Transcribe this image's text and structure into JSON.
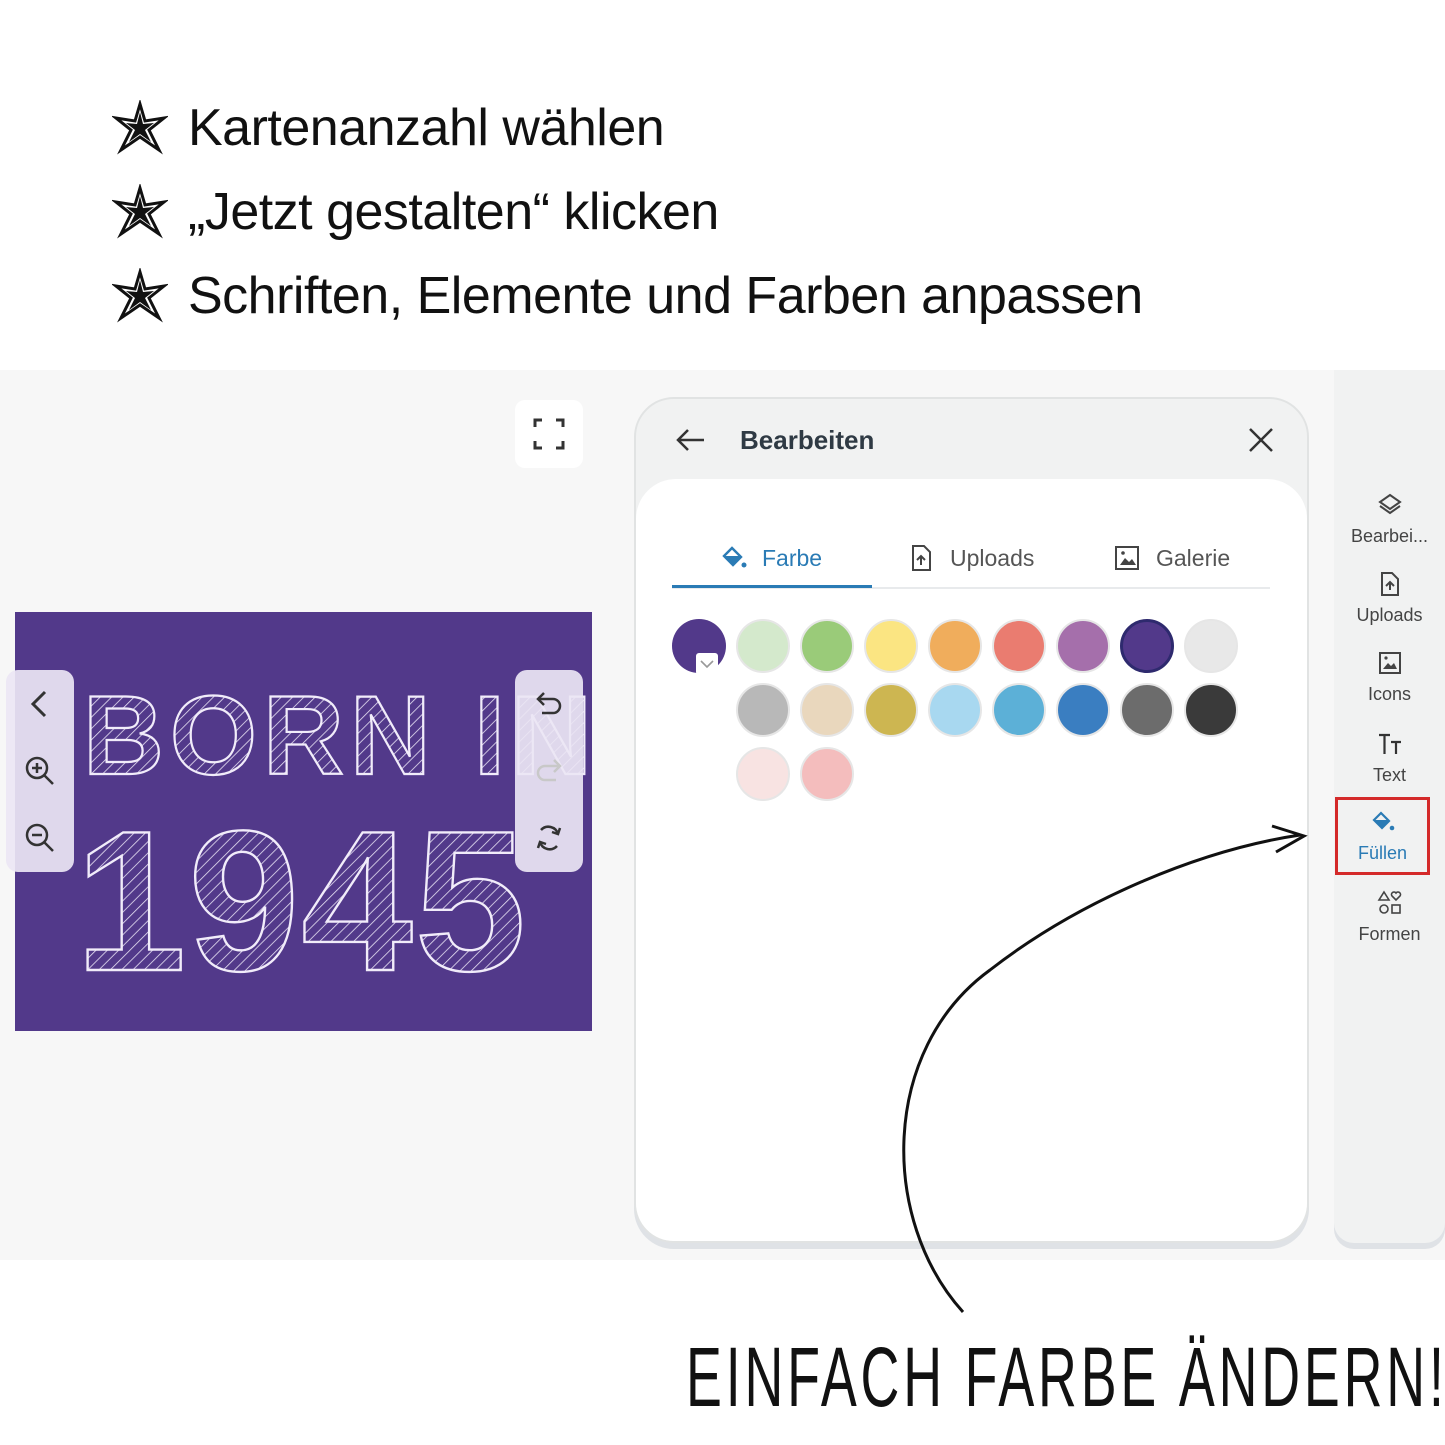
{
  "steps": [
    {
      "text": "Kartenanzahl wählen"
    },
    {
      "text": "„Jetzt gestalten“ klicken"
    },
    {
      "text": "Schriften, Elemente und Farben anpassen"
    }
  ],
  "card": {
    "line1": "BORN IN",
    "line2": "1945",
    "background": "#52398a"
  },
  "panel": {
    "title": "Bearbeiten",
    "tabs": [
      {
        "label": "Farbe",
        "icon": "paint-bucket-icon",
        "active": true
      },
      {
        "label": "Uploads",
        "icon": "upload-file-icon",
        "active": false
      },
      {
        "label": "Galerie",
        "icon": "image-icon",
        "active": false
      }
    ],
    "current_color": "#52398a",
    "swatches": [
      "#d4e9cc",
      "#9acb79",
      "#fbe582",
      "#f0ad5c",
      "#ea7c70",
      "#a56fab",
      "#52398a",
      "#e8e8e8",
      "#b8b8b8",
      "#e9d7bd",
      "#cdb651",
      "#a8d8f0",
      "#5cb0d7",
      "#3a7ec1",
      "#6c6c6c",
      "#3a3a3a",
      "#f8e3e2",
      "#f4bdbd"
    ],
    "selected_color": "#52398a"
  },
  "rail": {
    "items": [
      {
        "label": "Bearbei...",
        "icon": "layers-icon"
      },
      {
        "label": "Uploads",
        "icon": "upload-file-icon"
      },
      {
        "label": "Icons",
        "icon": "image-icon"
      },
      {
        "label": "Text",
        "icon": "text-size-icon"
      },
      {
        "label": "Füllen",
        "icon": "paint-bucket-icon",
        "active": true
      },
      {
        "label": "Formen",
        "icon": "shapes-icon"
      }
    ]
  },
  "annotation": {
    "text": "EINFACH FARBE ÄNDERN!"
  },
  "colors": {
    "accent": "#2a7bb5",
    "highlight": "#d42a2a"
  }
}
